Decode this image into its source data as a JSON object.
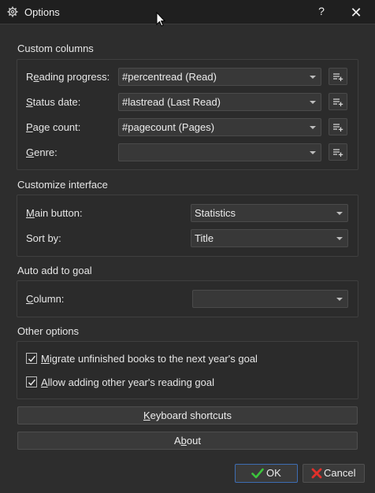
{
  "window": {
    "title": "Options",
    "help_label": "?",
    "close_label": "✕"
  },
  "custom_columns": {
    "title": "Custom columns",
    "rows": [
      {
        "label": "Reading progress:",
        "accel": "e",
        "value": "#percentread (Read)"
      },
      {
        "label": "Status date:",
        "accel": "S",
        "value": "#lastread (Last Read)"
      },
      {
        "label": "Page count:",
        "accel": "P",
        "value": "#pagecount (Pages)"
      },
      {
        "label": "Genre:",
        "accel": "G",
        "value": ""
      }
    ]
  },
  "customize_interface": {
    "title": "Customize interface",
    "main_button_label": "Main button:",
    "main_button_value": "Statistics",
    "sort_by_label": "Sort by:",
    "sort_by_value": "Title"
  },
  "auto_add_goal": {
    "title": "Auto add to goal",
    "column_label": "Column:",
    "column_value": ""
  },
  "other_options": {
    "title": "Other options",
    "migrate_label": "Migrate unfinished books to the next year's goal",
    "migrate_checked": true,
    "allow_label": "Allow adding other year's reading goal",
    "allow_checked": true
  },
  "buttons": {
    "keyboard_shortcuts": "Keyboard shortcuts",
    "about": "About",
    "ok": "OK",
    "cancel": "Cancel"
  },
  "colors": {
    "background": "#2d2d2d",
    "titlebar": "#1f1f1f",
    "ok_border": "#3d6db3",
    "ok_check": "#3cc43c",
    "cancel_x": "#e0302a"
  }
}
